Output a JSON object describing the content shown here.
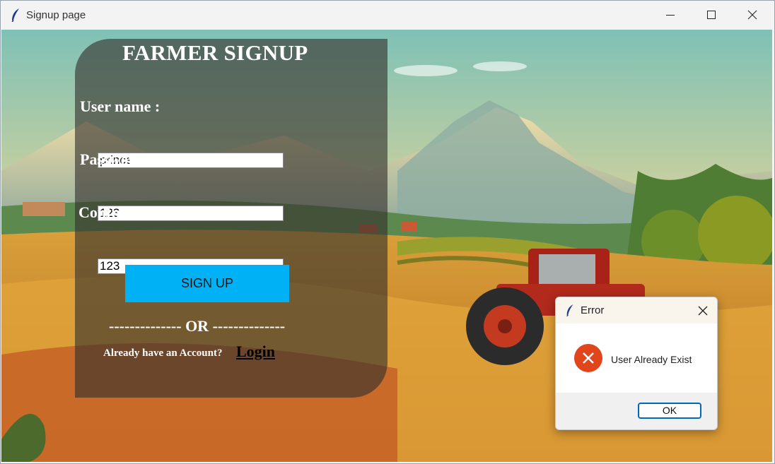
{
  "window": {
    "title": "Signup page"
  },
  "form": {
    "heading": "FARMER SIGNUP",
    "username_label": "User name :",
    "username_value": "prince",
    "password_label": "Password :",
    "password_value": "123",
    "confirm_label": "Confirm Password :",
    "confirm_value": "123",
    "signup_label": "SIGN UP",
    "or_text": "-------------- OR --------------",
    "already_text": "Already have an Account?",
    "login_label": "Login"
  },
  "dialog": {
    "title": "Error",
    "message": "User Already Exist",
    "ok_label": "OK"
  },
  "colors": {
    "signup_button": "#00b2f5",
    "panel_overlay": "rgba(52,48,45,0.62)",
    "error_icon": "#e0451c",
    "ok_border": "#0067c0"
  },
  "icons": [
    "feather-icon",
    "minimize-icon",
    "maximize-icon",
    "close-icon",
    "error-icon"
  ]
}
